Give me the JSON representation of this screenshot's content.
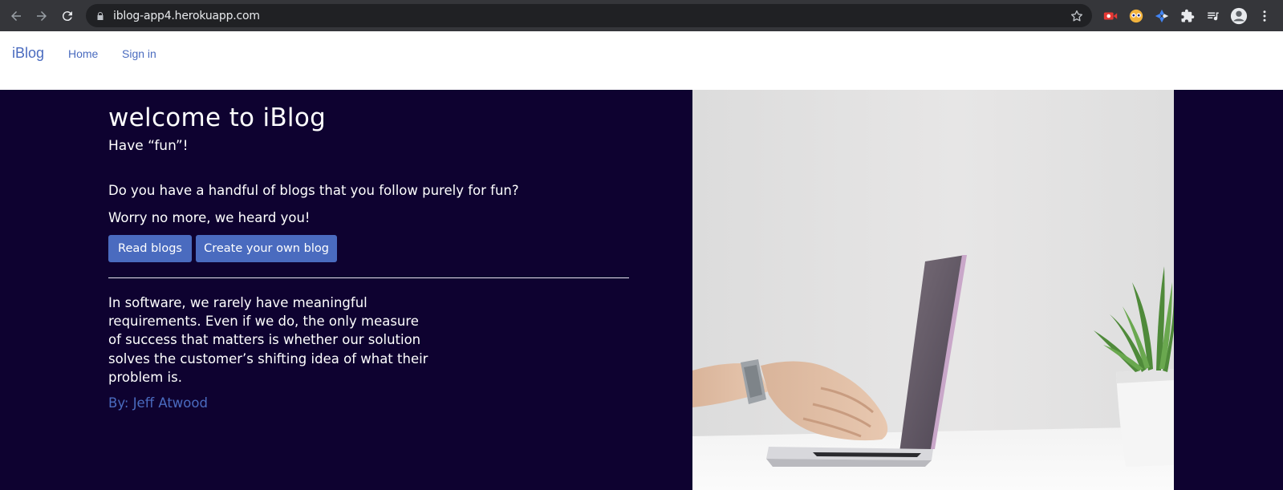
{
  "browser": {
    "url": "iblog-app4.herokuapp.com",
    "icons": [
      "back-icon",
      "forward-icon",
      "reload-icon",
      "lock-icon",
      "star-icon",
      "extension-icons",
      "puzzle-icon",
      "media-icon",
      "profile-icon",
      "menu-icon"
    ]
  },
  "navbar": {
    "brand": "iBlog",
    "links": [
      "Home",
      "Sign in"
    ]
  },
  "hero": {
    "title": "welcome to iBlog",
    "subtitle": "Have “fun”!",
    "question": "Do you have a handful of blogs that you follow purely for fun?",
    "reassurance": "Worry no more, we heard you!",
    "buttons": [
      "Read blogs",
      "Create your own blog"
    ],
    "quote": "In software, we rarely have meaningful requirements. Even if we do, the only measure of success that matters is whether our solution solves the customer’s shifting idea of what their problem is.",
    "author": "By: Jeff Atwood"
  },
  "colors": {
    "accent": "#4a6bbf",
    "hero_background": "#0e0230",
    "chrome": "#35363a",
    "omnibox": "#202124"
  }
}
